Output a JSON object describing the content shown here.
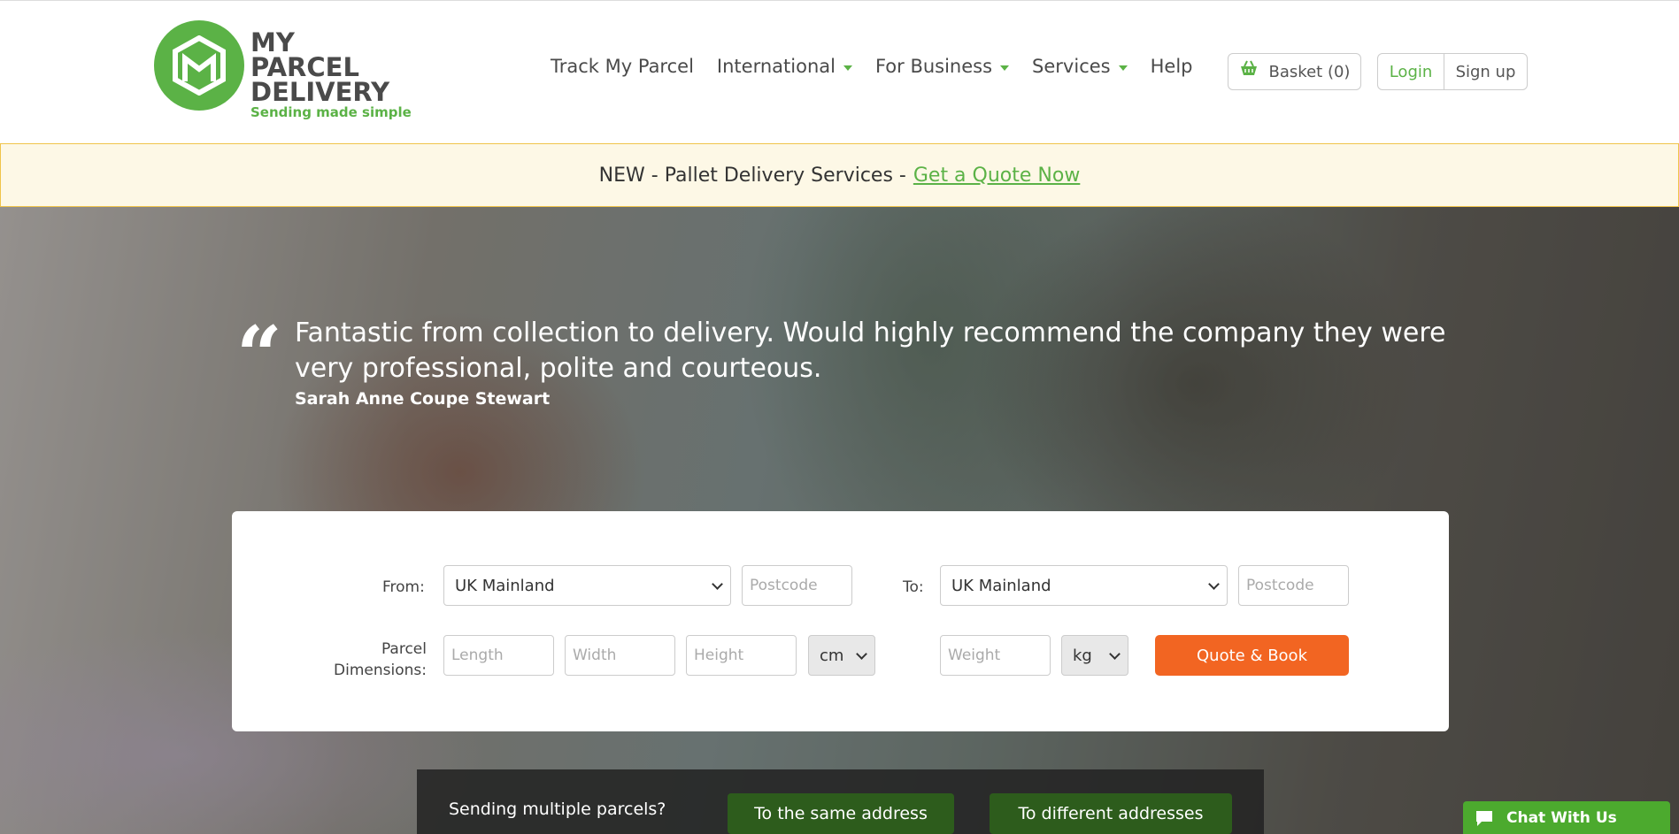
{
  "brand": {
    "line1": "MY",
    "line2": "PARCEL",
    "line3": "DELIVERY",
    "tagline": "Sending made simple",
    "accent": "#5bb246",
    "cta_color": "#f26522"
  },
  "nav": {
    "items": [
      {
        "label": "Track My Parcel",
        "dropdown": false
      },
      {
        "label": "International",
        "dropdown": true
      },
      {
        "label": "For Business",
        "dropdown": true
      },
      {
        "label": "Services",
        "dropdown": true
      },
      {
        "label": "Help",
        "dropdown": false
      }
    ],
    "basket": "Basket (0)",
    "login": "Login",
    "signup": "Sign up"
  },
  "banner": {
    "text": "NEW - Pallet Delivery Services -",
    "link": "Get a Quote Now"
  },
  "hero": {
    "quote": "Fantastic from collection to delivery. Would highly recommend the company they were very professional, polite and courteous.",
    "author": "Sarah Anne Coupe Stewart"
  },
  "form": {
    "from_label": "From:",
    "from_country": "UK Mainland",
    "from_postcode_placeholder": "Postcode",
    "to_label": "To:",
    "to_country": "UK Mainland",
    "to_postcode_placeholder": "Postcode",
    "dims_label_1": "Parcel",
    "dims_label_2": "Dimensions:",
    "length_placeholder": "Length",
    "width_placeholder": "Width",
    "height_placeholder": "Height",
    "dim_unit": "cm",
    "weight_placeholder": "Weight",
    "weight_unit": "kg",
    "submit": "Quote & Book"
  },
  "multi": {
    "label": "Sending multiple parcels?",
    "same": "To the same address",
    "different": "To different addresses"
  },
  "chat": {
    "label": "Chat With Us"
  }
}
